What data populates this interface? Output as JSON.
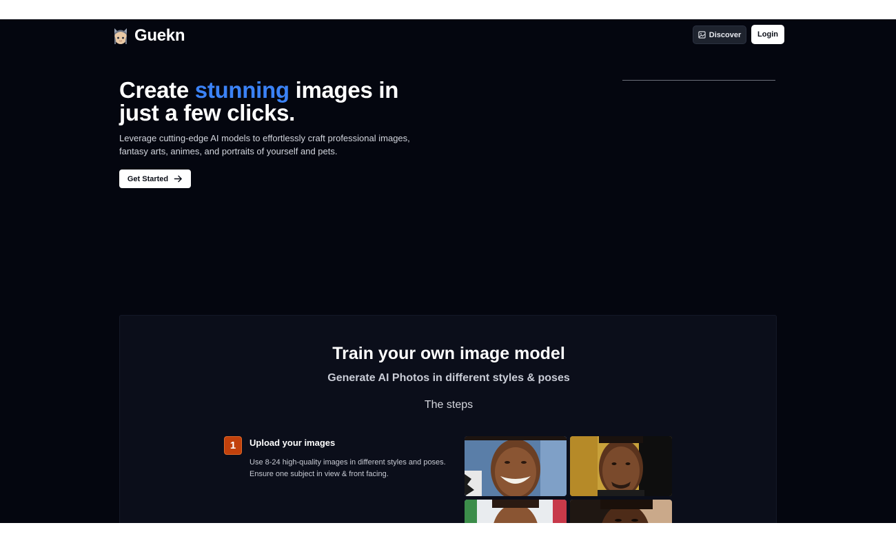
{
  "header": {
    "brand": "Guekn",
    "discover_label": "Discover",
    "login_label": "Login"
  },
  "hero": {
    "title_before": "Create ",
    "title_accent": "stunning",
    "title_after": " images in just a few clicks.",
    "subtitle": "Leverage cutting-edge AI models to effortlessly craft professional images, fantasy arts, animes, and portraits of yourself and pets.",
    "cta_label": "Get Started"
  },
  "section": {
    "title": "Train your own image model",
    "subtitle": "Generate AI Photos in different styles & poses",
    "steps_heading": "The steps",
    "steps": [
      {
        "number": "1",
        "title": "Upload your images",
        "description": "Use 8-24 high-quality images in different styles and poses. Ensure one subject in view & front facing."
      }
    ]
  },
  "colors": {
    "background": "#04060f",
    "accent": "#3b82f6",
    "step_badge": "#c2410c",
    "section_bg": "#0b0e1a"
  },
  "icons": {
    "discover": "images-icon",
    "cta": "arrow-right-icon",
    "logo": "cat-avatar-icon"
  }
}
